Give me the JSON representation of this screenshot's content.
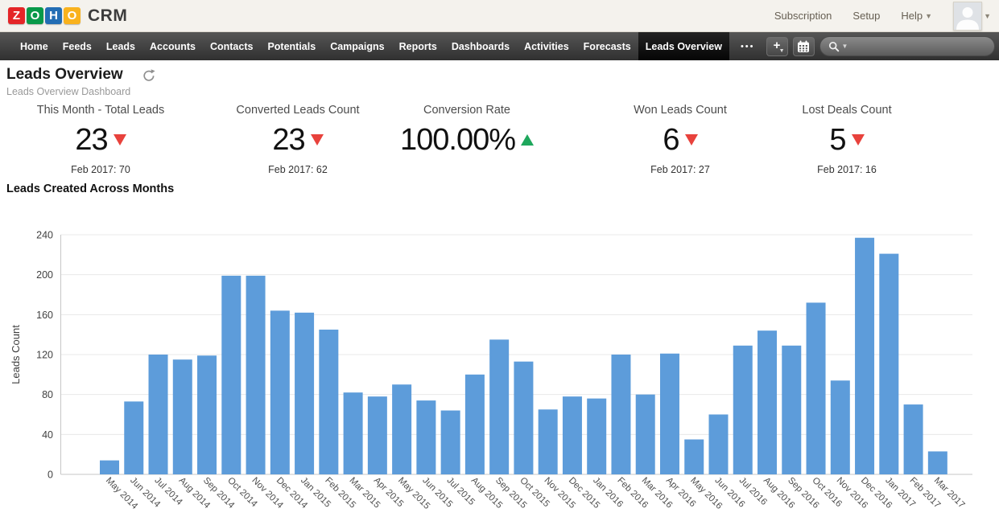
{
  "header": {
    "logo_letters": [
      {
        "char": "Z",
        "color": "#e42527"
      },
      {
        "char": "O",
        "color": "#089949"
      },
      {
        "char": "H",
        "color": "#226db4"
      },
      {
        "char": "O",
        "color": "#f9b21d"
      }
    ],
    "brand": "CRM",
    "links": [
      {
        "label": "Subscription",
        "has_caret": false
      },
      {
        "label": "Setup",
        "has_caret": false
      },
      {
        "label": "Help",
        "has_caret": true
      }
    ]
  },
  "nav": {
    "items": [
      "Home",
      "Feeds",
      "Leads",
      "Accounts",
      "Contacts",
      "Potentials",
      "Campaigns",
      "Reports",
      "Dashboards",
      "Activities",
      "Forecasts",
      "Leads Overview"
    ],
    "active": "Leads Overview",
    "overflow_label": "•••",
    "search_value": "",
    "search_placeholder": ""
  },
  "page": {
    "title": "Leads Overview",
    "subtitle": "Leads Overview Dashboard"
  },
  "kpis": [
    {
      "label": "This Month - Total Leads",
      "value": "23",
      "trend": "down",
      "compare": "Feb 2017: 70"
    },
    {
      "label": "Converted Leads Count",
      "value": "23",
      "trend": "down",
      "compare": "Feb 2017: 62"
    },
    {
      "label": "Conversion Rate",
      "value": "100.00%",
      "trend": "up",
      "compare": ""
    },
    {
      "label": "Won Leads Count",
      "value": "6",
      "trend": "down",
      "compare": "Feb 2017: 27"
    },
    {
      "label": "Lost Deals Count",
      "value": "5",
      "trend": "down",
      "compare": "Feb 2017: 16"
    }
  ],
  "section": {
    "heading": "Leads Created Across Months"
  },
  "chart_data": {
    "type": "bar",
    "title": "Leads Created Across Months",
    "xlabel": "",
    "ylabel": "Leads Count",
    "ylim": [
      0,
      240
    ],
    "yticks": [
      0,
      40,
      80,
      120,
      160,
      200,
      240
    ],
    "grid": true,
    "legend": false,
    "bar_color": "#5d9cda",
    "categories": [
      "May 2014",
      "Jun 2014",
      "Jul 2014",
      "Aug 2014",
      "Sep 2014",
      "Oct 2014",
      "Nov 2014",
      "Dec 2014",
      "Jan 2015",
      "Feb 2015",
      "Mar 2015",
      "Apr 2015",
      "May 2015",
      "Jun 2015",
      "Jul 2015",
      "Aug 2015",
      "Sep 2015",
      "Oct 2015",
      "Nov 2015",
      "Dec 2015",
      "Jan 2016",
      "Feb 2016",
      "Mar 2016",
      "Apr 2016",
      "May 2016",
      "Jun 2016",
      "Jul 2016",
      "Aug 2016",
      "Sep 2016",
      "Oct 2016",
      "Nov 2016",
      "Dec 2016",
      "Jan 2017",
      "Feb 2017",
      "Mar 2017"
    ],
    "values": [
      14,
      73,
      120,
      115,
      119,
      199,
      199,
      164,
      162,
      145,
      82,
      78,
      90,
      74,
      64,
      100,
      135,
      113,
      65,
      78,
      76,
      120,
      80,
      121,
      35,
      60,
      129,
      144,
      129,
      172,
      94,
      237,
      221,
      70,
      23
    ]
  },
  "colors": {
    "trend_down": "#e8423c",
    "trend_up": "#1ea75c",
    "bar": "#5d9cda",
    "nav_bg": "#3d3d3d",
    "header_bg": "#f4f2ed"
  }
}
